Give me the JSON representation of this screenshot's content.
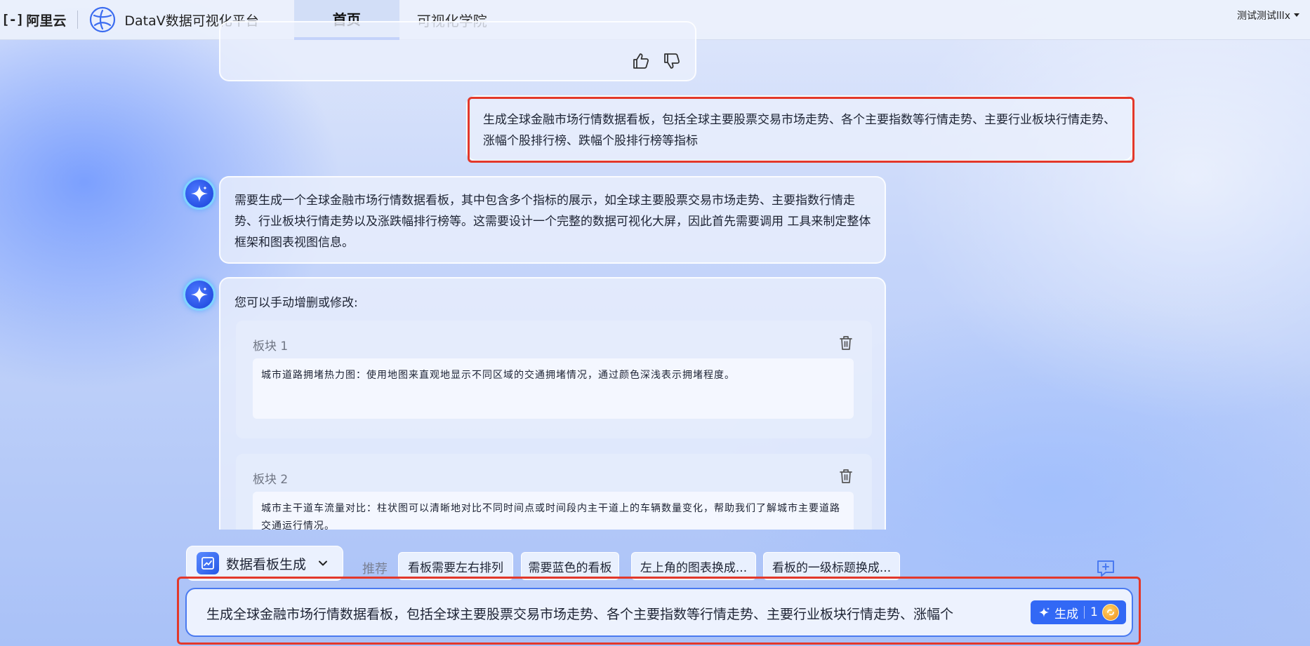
{
  "header": {
    "brand_mark": "[-]",
    "brand_name": "阿里云",
    "app_title": "DataV数据可视化平台",
    "tabs": [
      {
        "label": "首页",
        "active": true
      },
      {
        "label": "可视化学院",
        "active": false
      }
    ],
    "user_name": "测试测试lllx"
  },
  "chat": {
    "user_message": "生成全球金融市场行情数据看板，包括全球主要股票交易市场走势、各个主要指数等行情走势、主要行业板块行情走势、涨幅个股排行榜、跌幅个股排行榜等指标",
    "ai_message": "需要生成一个全球金融市场行情数据看板，其中包含多个指标的展示，如全球主要股票交易市场走势、主要指数行情走势、行业板块行情走势以及涨跌幅排行榜等。这需要设计一个完整的数据可视化大屏，因此首先需要调用 工具来制定整体框架和图表视图信息。",
    "ai_intro": "您可以手动增删或修改:",
    "blocks": [
      {
        "title": "板块 1",
        "description": "城市道路拥堵热力图：使用地图来直观地显示不同区域的交通拥堵情况，通过颜色深浅表示拥堵程度。"
      },
      {
        "title": "板块 2",
        "description": "城市主干道车流量对比：柱状图可以清晰地对比不同时间点或时间段内主干道上的车辆数量变化，帮助我们了解城市主要道路交通运行情况。"
      }
    ]
  },
  "toolbar": {
    "mode_label": "数据看板生成",
    "recommend_label": "推荐",
    "chips": [
      "看板需要左右排列",
      "需要蓝色的看板",
      "左上角的图表换成...",
      "看板的一级标题换成..."
    ]
  },
  "input": {
    "value": "生成全球金融市场行情数据看板，包括全球主要股票交易市场走势、各个主要指数等行情走势、主要行业板块行情走势、涨幅个",
    "generate_label": "生成",
    "credit_count": "1"
  },
  "colors": {
    "accent": "#3268f5",
    "highlight_border": "#e3382a"
  }
}
